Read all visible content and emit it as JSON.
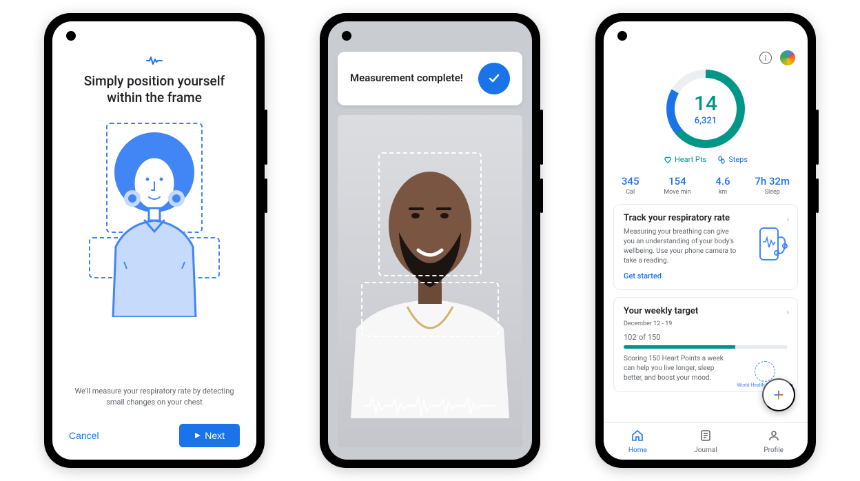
{
  "phone1": {
    "title": "Simply position yourself within the frame",
    "caption": "We'll measure your respiratory rate by detecting small changes on your chest",
    "cancel": "Cancel",
    "next": "Next"
  },
  "phone2": {
    "card_text": "Measurement complete!"
  },
  "phone3": {
    "ring": {
      "heart_pts": "14",
      "steps": "6,321"
    },
    "legend": {
      "heart": "Heart Pts",
      "steps": "Steps"
    },
    "stats": [
      {
        "val": "345",
        "lbl": "Cal"
      },
      {
        "val": "154",
        "lbl": "Move min"
      },
      {
        "val": "4.6",
        "lbl": "km"
      },
      {
        "val": "7h 32m",
        "lbl": "Sleep"
      }
    ],
    "card1": {
      "title": "Track your respiratory rate",
      "body": "Measuring your breathing can give you an understanding of your body's wellbeing. Use your phone camera to take a reading.",
      "link": "Get started"
    },
    "card2": {
      "title": "Your weekly target",
      "date": "December 12 - 19",
      "progress_val": "102",
      "progress_of": "of 150",
      "body": "Scoring 150 Heart Points a week can help you live longer, sleep better, and boost your mood.",
      "who": "World Health Organization"
    },
    "nav": {
      "home": "Home",
      "journal": "Journal",
      "profile": "Profile"
    }
  }
}
